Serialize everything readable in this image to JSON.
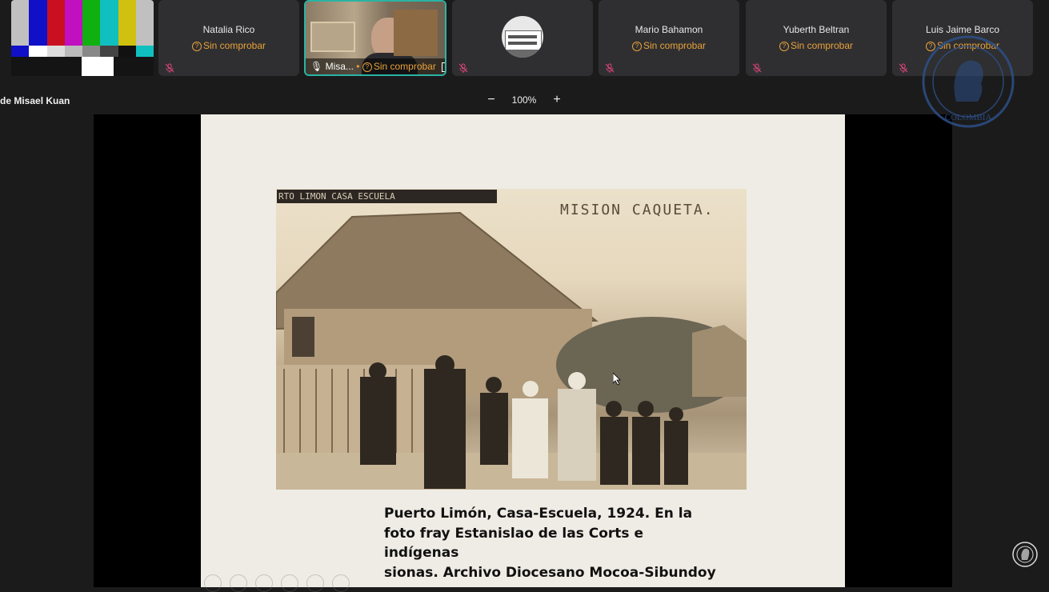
{
  "participants": [
    {
      "name": "Natalia Rico",
      "status": "Sin comprobar"
    },
    {
      "name": "",
      "status": ""
    },
    {
      "name": "Mario Bahamon",
      "status": "Sin comprobar"
    },
    {
      "name": "Yuberth Beltran",
      "status": "Sin comprobar"
    },
    {
      "name": "Luis Jaime Barco",
      "status": "Sin comprobar"
    }
  ],
  "active_speaker": {
    "short_name": "Misa...",
    "status": "Sin comprobar"
  },
  "presenter_label": "de Misael Kuan",
  "zoom": {
    "minus": "−",
    "level": "100%",
    "plus": "+"
  },
  "slide": {
    "photo_tag": "RTO LIMON  CASA ESCUELA",
    "photo_label": "MISION CAQUETA.",
    "caption_lines": [
      "Puerto Limón, Casa-Escuela, 1924. En la",
      "foto fray Estanislao de las Corts e indígenas",
      "sionas. Archivo Diocesano Mocoa-Sibundoy"
    ]
  },
  "seal_text": "COLOMBIA",
  "colors": {
    "accent": "#2bb3a4",
    "warning": "#e9a23b",
    "background": "#1b1b1c",
    "mic_muted": "#e0457b"
  },
  "icons": [
    "mic-muted-icon",
    "question-circle-icon",
    "mic-icon",
    "share-icon",
    "zoom-out-icon",
    "zoom-in-icon",
    "seal-logo-icon"
  ]
}
